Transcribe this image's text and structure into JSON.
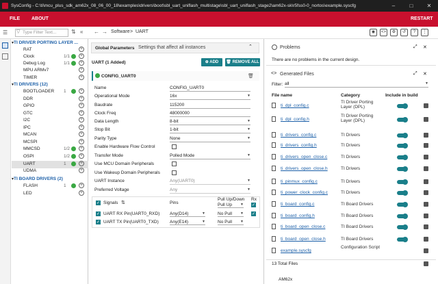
{
  "titlebar": {
    "title": "SysConfig - C:\\ti\\mcu_plus_sdk_am62x_08_06_00_18\\examples\\drivers\\boot\\sbl_uart_uniflash_multistage\\sbl_uart_uniflash_stage2\\am62x-sk\\r5fss0-0_nortos\\example.syscfg"
  },
  "menu": {
    "file": "FILE",
    "about": "ABOUT",
    "restart": "RESTART"
  },
  "search": {
    "placeholder": "Type Filter Text..."
  },
  "breadcrumb": {
    "root": "Software",
    "sep": ">",
    "current": "UART"
  },
  "sidebar": {
    "groups": [
      {
        "label": "TI DRIVER PORTING LAYER ..."
      },
      {
        "label": "TI DRIVERS (12)"
      },
      {
        "label": "TI BOARD DRIVERS (2)"
      }
    ],
    "items": [
      {
        "label": "RAT",
        "count": ""
      },
      {
        "label": "Clock",
        "count": "1/1"
      },
      {
        "label": "Debug Log",
        "count": "1/1"
      },
      {
        "label": "MPU ARMv7",
        "count": ""
      },
      {
        "label": "TIMER",
        "count": ""
      },
      {
        "label": "BOOTLOADER",
        "count": "1"
      },
      {
        "label": "DDR",
        "count": ""
      },
      {
        "label": "GPIO",
        "count": ""
      },
      {
        "label": "GTC",
        "count": ""
      },
      {
        "label": "I2C",
        "count": ""
      },
      {
        "label": "IPC",
        "count": ""
      },
      {
        "label": "MCAN",
        "count": ""
      },
      {
        "label": "MCSPI",
        "count": ""
      },
      {
        "label": "MMCSD",
        "count": "1/2"
      },
      {
        "label": "OSPI",
        "count": "1/2"
      },
      {
        "label": "UART",
        "count": "1"
      },
      {
        "label": "UDMA",
        "count": ""
      },
      {
        "label": "FLASH",
        "count": "1"
      },
      {
        "label": "LED",
        "count": ""
      }
    ]
  },
  "main": {
    "global_params": "Global Parameters",
    "global_desc": "Settings that affect all instances",
    "uart_header": "UART (1 Added)",
    "add_label": "ADD",
    "remove_all_label": "REMOVE ALL",
    "instance_name": "CONFIG_UART0",
    "fields": [
      {
        "label": "Name",
        "value": "CONFIG_UART0"
      },
      {
        "label": "Operational Mode",
        "value": "16x"
      },
      {
        "label": "Baudrate",
        "value": "115200"
      },
      {
        "label": "Clock Freq",
        "value": "48000000"
      },
      {
        "label": "Data Length",
        "value": "8-bit"
      },
      {
        "label": "Stop Bit",
        "value": "1-bit"
      },
      {
        "label": "Parity Type",
        "value": "None"
      },
      {
        "label": "Enable Hardware Flow Control",
        "value": ""
      },
      {
        "label": "Transfer Mode",
        "value": "Polled Mode"
      },
      {
        "label": "Use MCU Domain Peripherals",
        "value": ""
      },
      {
        "label": "Use Wakeup Domain Peripherals",
        "value": ""
      },
      {
        "label": "UART Instance",
        "value": "Any(UART0)"
      },
      {
        "label": "Preferred Voltage",
        "value": "Any"
      }
    ],
    "signals": {
      "label": "Signals",
      "pins_header": "Pins",
      "pull_header_1": "Pull Up/Down",
      "pull_header_2": "Pull Up",
      "rx_header": "Rx",
      "rows": [
        {
          "label": "UART RX Pin(UART0_RXD)",
          "pin": "Any(D14)",
          "pull": "No Pull"
        },
        {
          "label": "UART TX Pin(UART0_TXD)",
          "pin": "Any(E14)",
          "pull": "No Pull"
        }
      ]
    }
  },
  "problems": {
    "title": "Problems",
    "message": "There are no problems in the current design."
  },
  "generated": {
    "title": "Generated Files",
    "filter_label": "Filter:",
    "filter_value": "all",
    "col_file": "File name",
    "col_cat": "Category",
    "col_build": "Include in build",
    "files": [
      {
        "name": "ti_dpl_config.c",
        "cat": "TI Driver Porting Layer (DPL)"
      },
      {
        "name": "ti_dpl_config.h",
        "cat": "TI Driver Porting Layer (DPL)"
      },
      {
        "name": "ti_drivers_config.c",
        "cat": "TI Drivers"
      },
      {
        "name": "ti_drivers_config.h",
        "cat": "TI Drivers"
      },
      {
        "name": "ti_drivers_open_close.c",
        "cat": "TI Drivers"
      },
      {
        "name": "ti_drivers_open_close.h",
        "cat": "TI Drivers"
      },
      {
        "name": "ti_pinmux_config.c",
        "cat": "TI Drivers"
      },
      {
        "name": "ti_power_clock_config.c",
        "cat": "TI Drivers"
      },
      {
        "name": "ti_board_config.c",
        "cat": "TI Board Drivers"
      },
      {
        "name": "ti_board_config.h",
        "cat": "TI Board Drivers"
      },
      {
        "name": "ti_board_open_close.c",
        "cat": "TI Board Drivers"
      },
      {
        "name": "ti_board_open_close.h",
        "cat": "TI Board Drivers"
      },
      {
        "name": "example.syscfg",
        "cat": "Configuration Script"
      }
    ],
    "total": "13 Total Files"
  },
  "device": "AM62x",
  "colors": {
    "brand": "#c8102e",
    "accent": "#1a7f8a",
    "link": "#1b5fa8"
  }
}
